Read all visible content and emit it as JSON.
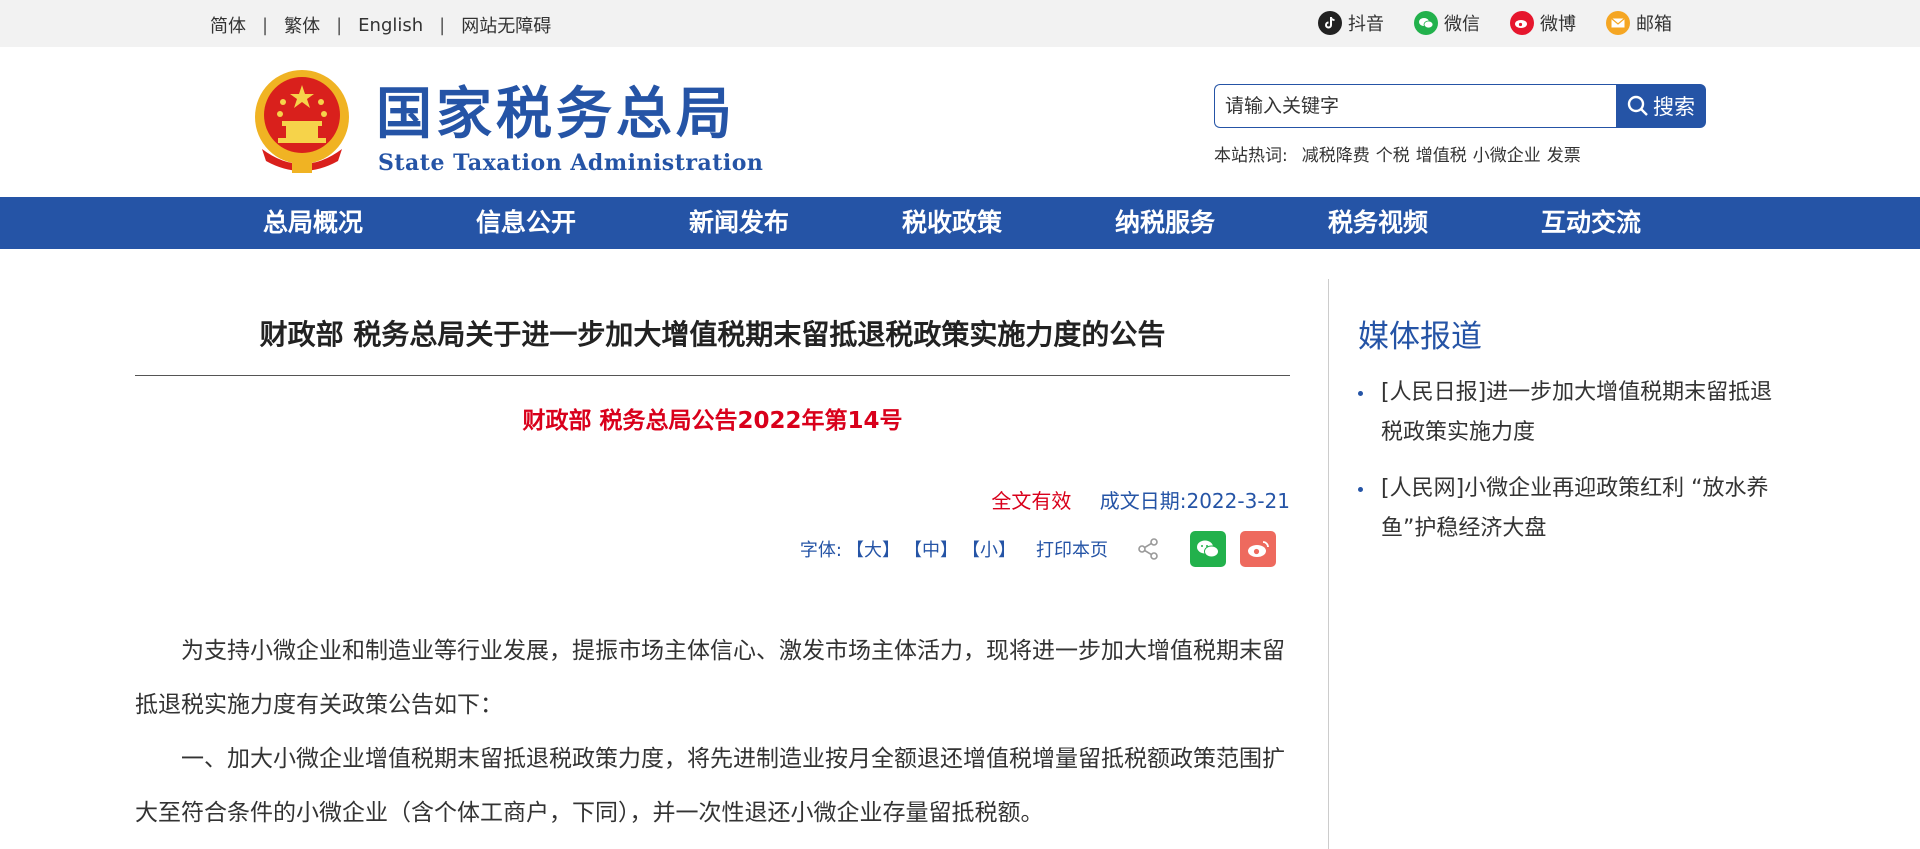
{
  "topbar": {
    "languages": [
      "简体",
      "繁体",
      "English",
      "网站无障碍"
    ],
    "social": [
      {
        "label": "抖音",
        "icon": "douyin-icon",
        "color": "#222222"
      },
      {
        "label": "微信",
        "icon": "wechat-icon",
        "color": "#22b14c"
      },
      {
        "label": "微博",
        "icon": "weibo-icon",
        "color": "#e6162d"
      },
      {
        "label": "邮箱",
        "icon": "mail-icon",
        "color": "#f5a623"
      }
    ]
  },
  "header": {
    "title": "国家税务总局",
    "subtitle": "State Taxation Administration",
    "search_placeholder": "请输入关键字",
    "search_button": "搜索",
    "hot_label": "本站热词:",
    "hot_words": [
      "减税降费",
      "个税",
      "增值税",
      "小微企业",
      "发票"
    ]
  },
  "nav": [
    "总局概况",
    "信息公开",
    "新闻发布",
    "税收政策",
    "纳税服务",
    "税务视频",
    "互动交流"
  ],
  "article": {
    "title": "财政部 税务总局关于进一步加大增值税期末留抵退税政策实施力度的公告",
    "doc_number": "财政部 税务总局公告2022年第14号",
    "validity": "全文有效",
    "date": "成文日期:2022-3-21",
    "font_label": "字体:",
    "font_sizes": [
      "【大】",
      "【中】",
      "【小】"
    ],
    "print": "打印本页",
    "paragraphs": [
      "为支持小微企业和制造业等行业发展，提振市场主体信心、激发市场主体活力，现将进一步加大增值税期末留抵退税实施力度有关政策公告如下：",
      "一、加大小微企业增值税期末留抵退税政策力度，将先进制造业按月全额退还增值税增量留抵税额政策范围扩大至符合条件的小微企业（含个体工商户，下同），并一次性退还小微企业存量留抵税额。"
    ]
  },
  "sidebar": {
    "title": "媒体报道",
    "items": [
      "[人民日报]进一步加大增值税期末留抵退税政策实施力度",
      "[人民网]小微企业再迎政策红利 “放水养鱼”护稳经济大盘"
    ]
  },
  "colors": {
    "brand": "#2554a6",
    "accent_red": "#d9001b",
    "wechat": "#22b14c",
    "weibo": "#ee6a5e"
  }
}
